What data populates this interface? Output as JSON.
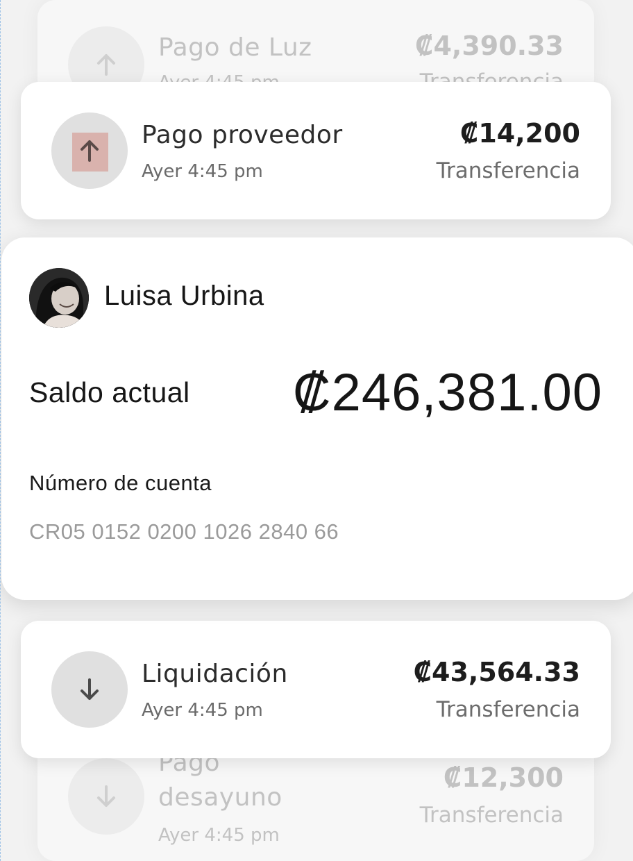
{
  "transactions": [
    {
      "name": "Pago de Luz",
      "time": "Ayer 4:45 pm",
      "amount": "₡4,390.33",
      "type": "Transferencia",
      "direction": "up",
      "icon": "arrow-up-icon"
    },
    {
      "name": "Pago proveedor",
      "time": "Ayer 4:45 pm",
      "amount": "₡14,200",
      "type": "Transferencia",
      "direction": "up",
      "icon": "arrow-up-icon"
    },
    {
      "name": "Liquidación",
      "time": "Ayer 4:45 pm",
      "amount": "₡43,564.33",
      "type": "Transferencia",
      "direction": "down",
      "icon": "arrow-down-icon"
    },
    {
      "name_line1": "Pago",
      "name_line2": "desayuno",
      "time": "Ayer 4:45 pm",
      "amount": "₡12,300",
      "type": "Transferencia",
      "direction": "down",
      "icon": "arrow-down-icon"
    }
  ],
  "account": {
    "user_name": "Luisa Urbina",
    "balance_label": "Saldo actual",
    "balance": "₡246,381.00",
    "account_label": "Número de cuenta",
    "account_number": "CR05 0152 0200 1026 2840 66"
  },
  "colors": {
    "card_bg": "#ffffff",
    "page_bg": "#f2f2f2",
    "icon_bg": "#e0e0e0",
    "highlight": "#d9b2ad",
    "primary_text": "#161616",
    "secondary_text": "#6c6c6c",
    "faded_text": "#c2c2c2"
  }
}
